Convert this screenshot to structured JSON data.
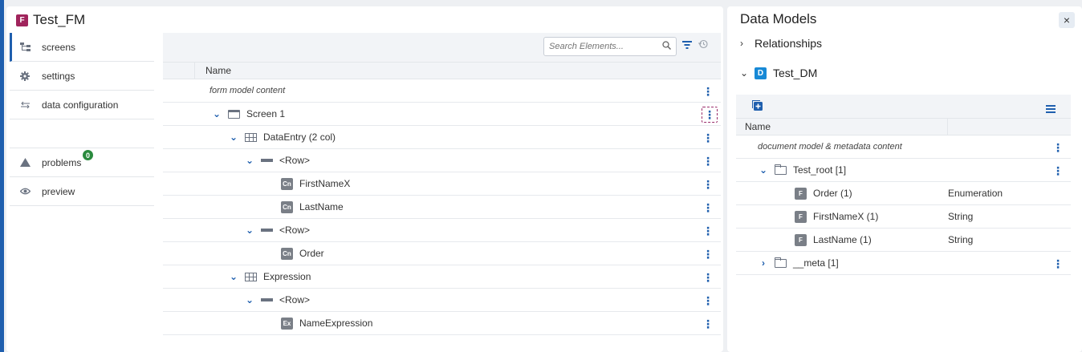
{
  "form_model": {
    "badge": "F",
    "title": "Test_FM"
  },
  "sidenav": {
    "items": [
      {
        "label": "screens",
        "icon": "screens-icon"
      },
      {
        "label": "settings",
        "icon": "gear-icon"
      },
      {
        "label": "data configuration",
        "icon": "swap-arrows-icon"
      }
    ],
    "problems": {
      "label": "problems",
      "count": "0",
      "icon": "warning-triangle-icon"
    },
    "preview": {
      "label": "preview",
      "icon": "eye-icon"
    }
  },
  "tree": {
    "search_placeholder": "Search Elements...",
    "header_name": "Name",
    "rows": [
      {
        "label": "form model content",
        "indent": 0,
        "style": "italic"
      },
      {
        "label": "Screen 1",
        "indent": 1,
        "icon": "screen-icon"
      },
      {
        "label": "DataEntry (2 col)",
        "indent": 2,
        "icon": "grid-icon"
      },
      {
        "label": "<Row>",
        "indent": 3,
        "icon": "row-icon"
      },
      {
        "label": "FirstNameX",
        "indent": 4,
        "icon": "Cn"
      },
      {
        "label": "LastName",
        "indent": 4,
        "icon": "Cn"
      },
      {
        "label": "<Row>",
        "indent": 3,
        "icon": "row-icon"
      },
      {
        "label": "Order",
        "indent": 4,
        "icon": "Cn"
      },
      {
        "label": "Expression",
        "indent": 2,
        "icon": "grid-icon"
      },
      {
        "label": "<Row>",
        "indent": 3,
        "icon": "row-icon"
      },
      {
        "label": "NameExpression",
        "indent": 4,
        "icon": "Ex"
      }
    ]
  },
  "data_models": {
    "title": "Data Models",
    "close": "×",
    "relationships": "Relationships",
    "dm_badge": "D",
    "dm_name": "Test_DM",
    "header_name": "Name",
    "rows": [
      {
        "label": "document model & metadata content",
        "type": ""
      },
      {
        "label": "Test_root [1]",
        "type": ""
      },
      {
        "label": "Order (1)",
        "type": "Enumeration",
        "badge": "F"
      },
      {
        "label": "FirstNameX (1)",
        "type": "String",
        "badge": "F"
      },
      {
        "label": "LastName (1)",
        "type": "String",
        "badge": "F"
      },
      {
        "label": "__meta [1]",
        "type": ""
      }
    ]
  },
  "colors": {
    "accent": "#1f5fae",
    "form_badge": "#a0245c",
    "dm_badge": "#1789d6",
    "success": "#2a8a3e"
  }
}
